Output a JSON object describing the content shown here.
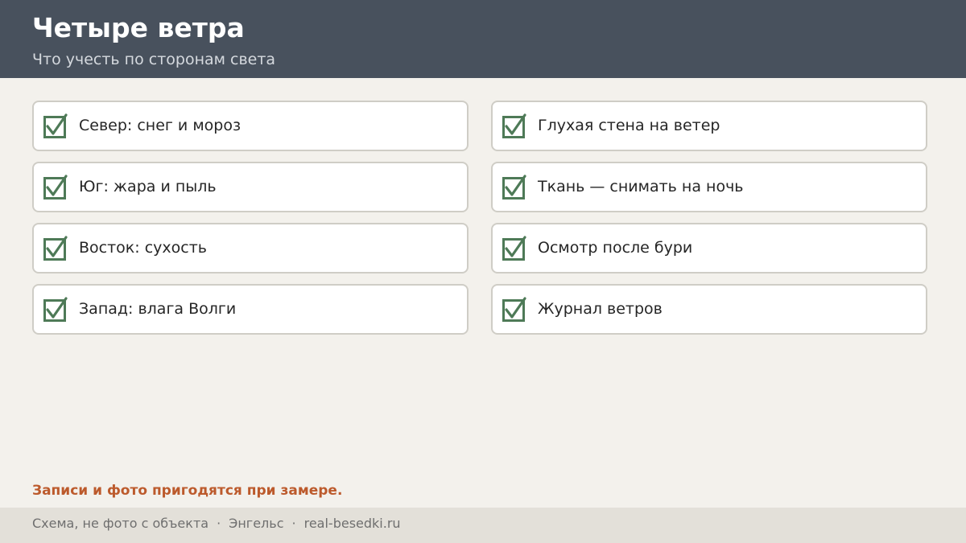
{
  "header": {
    "title": "Четыре ветра",
    "subtitle": "Что учесть по сторонам света"
  },
  "checklist": {
    "left": [
      {
        "label": "Север: снег и мороз",
        "checked": true
      },
      {
        "label": "Юг: жара и пыль",
        "checked": true
      },
      {
        "label": "Восток: сухость",
        "checked": true
      },
      {
        "label": "Запад: влага Волги",
        "checked": true
      }
    ],
    "right": [
      {
        "label": "Глухая стена на ветер",
        "checked": true
      },
      {
        "label": "Ткань — снимать на ночь",
        "checked": true
      },
      {
        "label": "Осмотр после бури",
        "checked": true
      },
      {
        "label": "Журнал ветров",
        "checked": true
      }
    ]
  },
  "note": "Записи и фото пригодятся при замере.",
  "footer": {
    "caption": "Схема, не фото с объекта",
    "separator": "·",
    "city": "Энгельс",
    "site": "real-besedki.ru"
  },
  "colors": {
    "header_bg": "#48515d",
    "page_bg": "#f3f1ec",
    "check_green": "#4e7a57",
    "note_orange": "#bc5a2c",
    "footer_bg": "#e3e0d9"
  },
  "icons": {
    "checkbox": "checkmark-icon"
  }
}
